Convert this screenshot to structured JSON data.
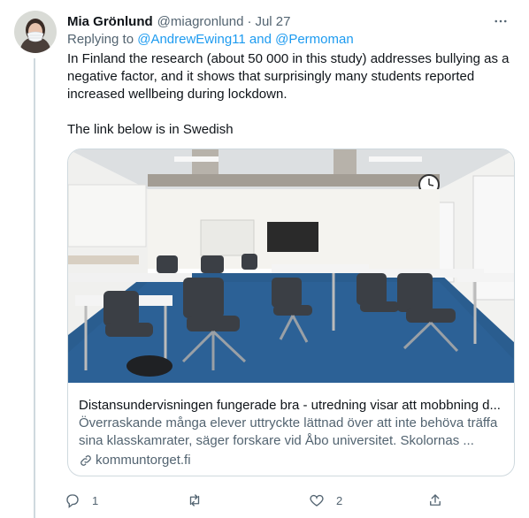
{
  "tweet": {
    "author_name": "Mia Grönlund",
    "author_handle": "@miagronlund",
    "separator": "·",
    "date": "Jul 27",
    "replying_prefix": "Replying to",
    "replying_user_1": "@AndrewEwing11",
    "replying_and": "and",
    "replying_user_2": "@Permoman",
    "text_paragraph_1": "In Finland the research (about 50 000 in this study) addresses bullying as a negative factor, and it shows that surprisingly many students reported increased wellbeing during lockdown.",
    "text_paragraph_2": "The link below is in Swedish"
  },
  "card": {
    "title": "Distansundervisningen fungerade bra - utredning visar att mobbning d...",
    "description": "Överraskande många elever uttryckte lättnad över att inte behöva träffa sina klasskamrater, säger forskare vid Åbo universitet. Skolornas ...",
    "domain": "kommuntorget.fi",
    "image_subject": "empty classroom with blue carpet, white desks and black chairs"
  },
  "actions": {
    "reply_count": "1",
    "retweet_count": "",
    "like_count": "2"
  },
  "icons": [
    "avatar",
    "more-icon",
    "link-icon",
    "reply-icon",
    "retweet-icon",
    "like-icon",
    "share-icon"
  ],
  "colors": {
    "text": "#0f1419",
    "secondary": "#536471",
    "link": "#1d9bf0",
    "border": "#cfd9de",
    "carpet": "#2a5d8f"
  }
}
